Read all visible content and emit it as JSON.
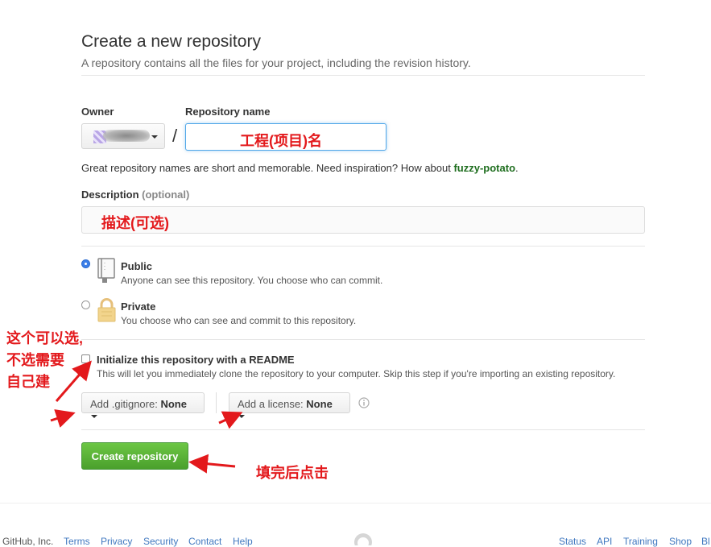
{
  "header": {
    "title": "Create a new repository",
    "subtitle": "A repository contains all the files for your project, including the revision history."
  },
  "owner": {
    "label": "Owner",
    "separator": "/"
  },
  "repo_name": {
    "label": "Repository name",
    "value": ""
  },
  "hint": {
    "text": "Great repository names are short and memorable. Need inspiration? How about ",
    "suggestion": "fuzzy-potato",
    "end": "."
  },
  "description": {
    "label": "Description",
    "optional": "(optional)",
    "value": ""
  },
  "visibility": {
    "public": {
      "title": "Public",
      "desc": "Anyone can see this repository. You choose who can commit.",
      "selected": true
    },
    "private": {
      "title": "Private",
      "desc": "You choose who can see and commit to this repository.",
      "selected": false
    }
  },
  "readme": {
    "title": "Initialize this repository with a README",
    "desc": "This will let you immediately clone the repository to your computer. Skip this step if you're importing an existing repository.",
    "checked": false
  },
  "gitignore": {
    "prefix": "Add .gitignore:",
    "value": "None"
  },
  "license": {
    "prefix": "Add a license:",
    "value": "None"
  },
  "create_button": "Create repository",
  "annotations": {
    "repo_name": "工程(项目)名",
    "description": "描述(可选)",
    "optional_line1": "这个可以选,",
    "optional_line2": "不选需要",
    "optional_line3": "自己建",
    "click_after": "填完后点击",
    "color": "#e3191c"
  },
  "footer": {
    "company": "GitHub, Inc.",
    "links_left": [
      "Terms",
      "Privacy",
      "Security",
      "Contact",
      "Help"
    ],
    "links_right": [
      "Status",
      "API",
      "Training",
      "Shop",
      "Bl"
    ]
  },
  "colors": {
    "link": "#4078c0",
    "green": "#6cc644",
    "focus": "#51a7e8"
  }
}
